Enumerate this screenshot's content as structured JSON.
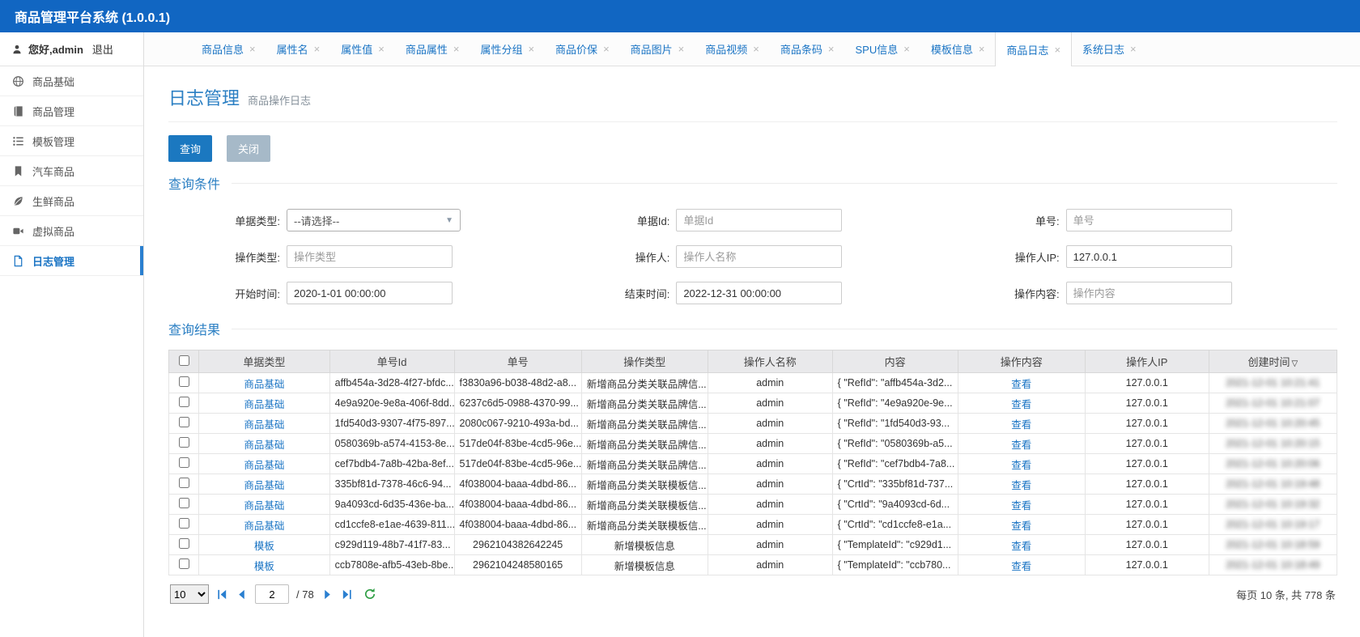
{
  "app": {
    "title": "商品管理平台系统 (1.0.0.1)"
  },
  "sidebar": {
    "user": {
      "greeting": "您好,admin",
      "logout": "退出"
    },
    "items": [
      {
        "name": "sidebar-item-goods-base",
        "label": "商品基础",
        "icon": "globe-icon",
        "active": false
      },
      {
        "name": "sidebar-item-goods-manage",
        "label": "商品管理",
        "icon": "book-icon",
        "active": false
      },
      {
        "name": "sidebar-item-template-manage",
        "label": "模板管理",
        "icon": "list-icon",
        "active": false
      },
      {
        "name": "sidebar-item-car-goods",
        "label": "汽车商品",
        "icon": "bookmark-icon",
        "active": false
      },
      {
        "name": "sidebar-item-fresh-goods",
        "label": "生鲜商品",
        "icon": "leaf-icon",
        "active": false
      },
      {
        "name": "sidebar-item-virtual-goods",
        "label": "虚拟商品",
        "icon": "camera-icon",
        "active": false
      },
      {
        "name": "sidebar-item-log-manage",
        "label": "日志管理",
        "icon": "file-icon",
        "active": true
      }
    ]
  },
  "tabs": [
    {
      "label": "商品信息",
      "active": false
    },
    {
      "label": "属性名",
      "active": false
    },
    {
      "label": "属性值",
      "active": false
    },
    {
      "label": "商品属性",
      "active": false
    },
    {
      "label": "属性分组",
      "active": false
    },
    {
      "label": "商品价保",
      "active": false
    },
    {
      "label": "商品图片",
      "active": false
    },
    {
      "label": "商品视频",
      "active": false
    },
    {
      "label": "商品条码",
      "active": false
    },
    {
      "label": "SPU信息",
      "active": false
    },
    {
      "label": "模板信息",
      "active": false
    },
    {
      "label": "商品日志",
      "active": true
    },
    {
      "label": "系统日志",
      "active": false
    }
  ],
  "page": {
    "title": "日志管理",
    "subtitle": "商品操作日志"
  },
  "toolbar": {
    "query_label": "查询",
    "close_label": "关闭"
  },
  "query_section": {
    "title": "查询条件",
    "fields": [
      {
        "name": "doc-type-select",
        "label": "单据类型:",
        "type": "select",
        "value": "--请选择--"
      },
      {
        "name": "doc-id-input",
        "label": "单据Id:",
        "type": "input",
        "placeholder": "单据Id"
      },
      {
        "name": "doc-no-input",
        "label": "单号:",
        "type": "input",
        "placeholder": "单号"
      },
      {
        "name": "op-type-input",
        "label": "操作类型:",
        "type": "input",
        "placeholder": "操作类型"
      },
      {
        "name": "operator-input",
        "label": "操作人:",
        "type": "input",
        "placeholder": "操作人名称"
      },
      {
        "name": "operator-ip-input",
        "label": "操作人IP:",
        "type": "input",
        "value": "127.0.0.1"
      },
      {
        "name": "start-time-input",
        "label": "开始时间:",
        "type": "input",
        "value": "2020-1-01 00:00:00"
      },
      {
        "name": "end-time-input",
        "label": "结束时间:",
        "type": "input",
        "value": "2022-12-31 00:00:00"
      },
      {
        "name": "op-content-input",
        "label": "操作内容:",
        "type": "input",
        "placeholder": "操作内容"
      }
    ]
  },
  "results_section": {
    "title": "查询结果"
  },
  "table": {
    "view_label": "查看",
    "sort_caret": "▽",
    "columns": [
      "单据类型",
      "单号Id",
      "单号",
      "操作类型",
      "操作人名称",
      "内容",
      "操作内容",
      "操作人IP",
      "创建时间"
    ],
    "rows": [
      {
        "doc_type": "商品基础",
        "ref_id": "affb454a-3d28-4f27-bfdc...",
        "doc_no": "f3830a96-b038-48d2-a8...",
        "op_type": "新增商品分类关联品牌信...",
        "operator": "admin",
        "content": "{ \"RefId\": \"affb454a-3d2...",
        "ip": "127.0.0.1",
        "created": "2021-12-01 10:21:41"
      },
      {
        "doc_type": "商品基础",
        "ref_id": "4e9a920e-9e8a-406f-8dd...",
        "doc_no": "6237c6d5-0988-4370-99...",
        "op_type": "新增商品分类关联品牌信...",
        "operator": "admin",
        "content": "{ \"RefId\": \"4e9a920e-9e...",
        "ip": "127.0.0.1",
        "created": "2021-12-01 10:21:07"
      },
      {
        "doc_type": "商品基础",
        "ref_id": "1fd540d3-9307-4f75-897...",
        "doc_no": "2080c067-9210-493a-bd...",
        "op_type": "新增商品分类关联品牌信...",
        "operator": "admin",
        "content": "{ \"RefId\": \"1fd540d3-93...",
        "ip": "127.0.0.1",
        "created": "2021-12-01 10:20:45"
      },
      {
        "doc_type": "商品基础",
        "ref_id": "0580369b-a574-4153-8e...",
        "doc_no": "517de04f-83be-4cd5-96e...",
        "op_type": "新增商品分类关联品牌信...",
        "operator": "admin",
        "content": "{ \"RefId\": \"0580369b-a5...",
        "ip": "127.0.0.1",
        "created": "2021-12-01 10:20:15"
      },
      {
        "doc_type": "商品基础",
        "ref_id": "cef7bdb4-7a8b-42ba-8ef...",
        "doc_no": "517de04f-83be-4cd5-96e...",
        "op_type": "新增商品分类关联品牌信...",
        "operator": "admin",
        "content": "{ \"RefId\": \"cef7bdb4-7a8...",
        "ip": "127.0.0.1",
        "created": "2021-12-01 10:20:06"
      },
      {
        "doc_type": "商品基础",
        "ref_id": "335bf81d-7378-46c6-94...",
        "doc_no": "4f038004-baaa-4dbd-86...",
        "op_type": "新增商品分类关联模板信...",
        "operator": "admin",
        "content": "{ \"CrtId\": \"335bf81d-737...",
        "ip": "127.0.0.1",
        "created": "2021-12-01 10:19:48"
      },
      {
        "doc_type": "商品基础",
        "ref_id": "9a4093cd-6d35-436e-ba...",
        "doc_no": "4f038004-baaa-4dbd-86...",
        "op_type": "新增商品分类关联模板信...",
        "operator": "admin",
        "content": "{ \"CrtId\": \"9a4093cd-6d...",
        "ip": "127.0.0.1",
        "created": "2021-12-01 10:19:32"
      },
      {
        "doc_type": "商品基础",
        "ref_id": "cd1ccfe8-e1ae-4639-811...",
        "doc_no": "4f038004-baaa-4dbd-86...",
        "op_type": "新增商品分类关联模板信...",
        "operator": "admin",
        "content": "{ \"CrtId\": \"cd1ccfe8-e1a...",
        "ip": "127.0.0.1",
        "created": "2021-12-01 10:19:17"
      },
      {
        "doc_type": "模板",
        "ref_id": "c929d119-48b7-41f7-83...",
        "doc_no": "2962104382642245",
        "op_type": "新增模板信息",
        "operator": "admin",
        "content": "{ \"TemplateId\": \"c929d1...",
        "ip": "127.0.0.1",
        "created": "2021-12-01 10:18:59"
      },
      {
        "doc_type": "模板",
        "ref_id": "ccb7808e-afb5-43eb-8be...",
        "doc_no": "2962104248580165",
        "op_type": "新增模板信息",
        "operator": "admin",
        "content": "{ \"TemplateId\": \"ccb780...",
        "ip": "127.0.0.1",
        "created": "2021-12-01 10:18:49"
      }
    ]
  },
  "pagination": {
    "page_size_options": [
      "10"
    ],
    "page_size": "10",
    "current_page": "2",
    "total_pages": "/ 78",
    "summary": "每页 10 条, 共 778 条"
  }
}
